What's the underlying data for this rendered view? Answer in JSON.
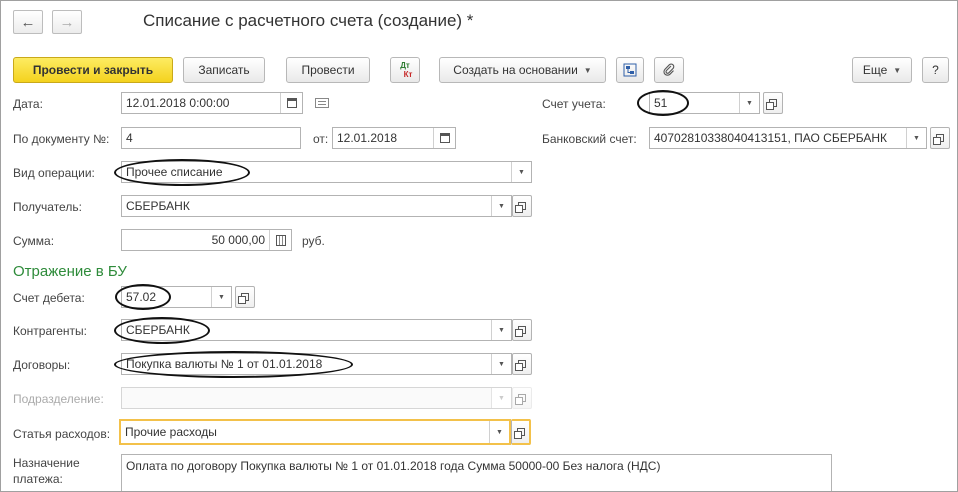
{
  "window": {
    "title": "Списание с расчетного счета (создание) *"
  },
  "toolbar": {
    "post_close": "Провести и закрыть",
    "save": "Записать",
    "post": "Провести",
    "dtkt_top": "Дт",
    "dtkt_bottom": "Кт",
    "create_based": "Создать на основании",
    "more": "Еще",
    "help": "?"
  },
  "form": {
    "date": {
      "label": "Дата:",
      "value": "12.01.2018  0:00:00"
    },
    "doc_no": {
      "label": "По документу №:",
      "value": "4"
    },
    "doc_date": {
      "label": "от:",
      "value": "12.01.2018"
    },
    "account": {
      "label": "Счет учета:",
      "value": "51"
    },
    "bank_account": {
      "label": "Банковский счет:",
      "value": "40702810338040413151, ПАО СБЕРБАНК"
    },
    "operation": {
      "label": "Вид операции:",
      "value": "Прочее списание"
    },
    "recipient": {
      "label": "Получатель:",
      "value": "СБЕРБАНК"
    },
    "amount": {
      "label": "Сумма:",
      "value": "50 000,00",
      "currency": "руб."
    },
    "section_title": "Отражение в БУ",
    "debit_account": {
      "label": "Счет дебета:",
      "value": "57.02"
    },
    "counterparties": {
      "label": "Контрагенты:",
      "value": "СБЕРБАНК"
    },
    "contracts": {
      "label": "Договоры:",
      "value": "Покупка валюты № 1 от 01.01.2018"
    },
    "department": {
      "label": "Подразделение:",
      "value": ""
    },
    "expense_item": {
      "label": "Статья расходов:",
      "value": "Прочие расходы"
    },
    "purpose": {
      "label_line1": "Назначение",
      "label_line2": "платежа:",
      "value": "Оплата по договору Покупка валюты № 1 от 01.01.2018 года Сумма 50000-00 Без налога (НДС)"
    }
  }
}
